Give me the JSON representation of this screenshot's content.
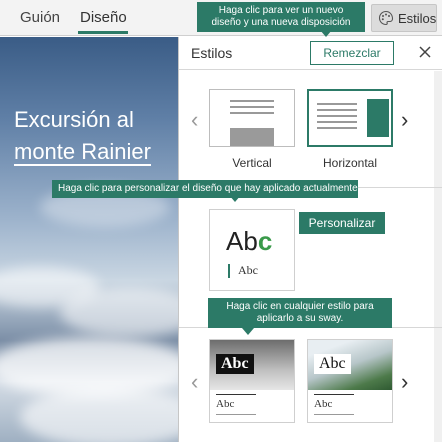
{
  "tabs": {
    "guion": "Guión",
    "diseno": "Diseño"
  },
  "toolbar": {
    "styles_label": "Estilos"
  },
  "preview": {
    "title_line1": "Excursión al",
    "title_line2": "monte Rainier"
  },
  "panel": {
    "title": "Estilos",
    "remix_label": "Remezclar",
    "layouts": [
      {
        "label": "Vertical"
      },
      {
        "label": "Horizontal"
      }
    ],
    "personalize_label": "Personalizar",
    "style_sample_text": "Abc",
    "style_sample_big": "Ab",
    "style_sample_big_accent": "c"
  },
  "callouts": {
    "remix_tip": "Haga clic para ver un nuevo diseño y una nueva disposición",
    "personalize_tip": "Haga clic para personalizar el diseño que hay aplicado actualmente.",
    "apply_tip": "Haga clic en cualquier estilo para aplicarlo a su sway."
  },
  "colors": {
    "accent": "#2c7a67",
    "topbar": "#f3f3f3"
  }
}
